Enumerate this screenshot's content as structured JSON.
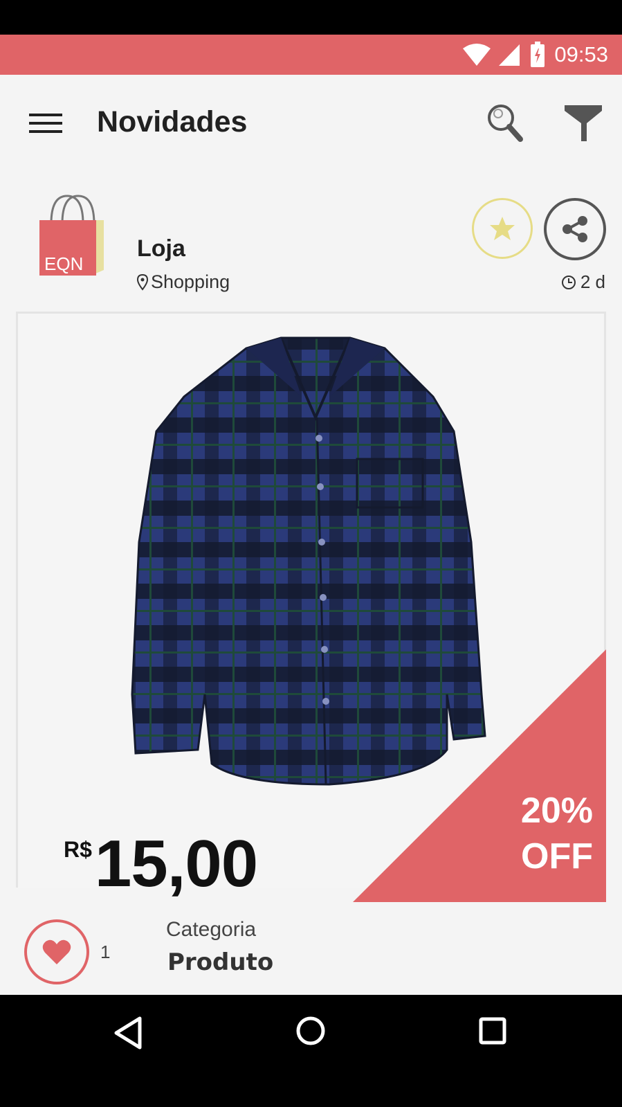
{
  "status_bar": {
    "time": "09:53"
  },
  "app_bar": {
    "title": "Novidades"
  },
  "store": {
    "logo_text": "EQN",
    "name": "Loja",
    "location": "Shopping",
    "age": "2 d"
  },
  "product": {
    "currency": "R$",
    "price": "15,00",
    "discount_line1": "20%",
    "discount_line2": "OFF",
    "likes": "1",
    "category_label": "Categoria",
    "category_value": "Produto"
  },
  "colors": {
    "accent": "#e06467",
    "star": "#e6dc86",
    "background": "#f4f4f4"
  }
}
